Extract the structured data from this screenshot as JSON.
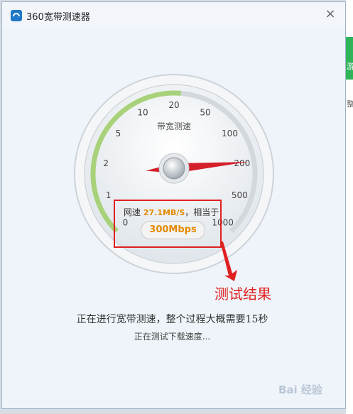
{
  "window": {
    "title": "360宽带测速器",
    "close_icon": "×"
  },
  "gauge": {
    "label": "带宽测速",
    "ticks": [
      "0",
      "1",
      "2",
      "5",
      "10",
      "20",
      "50",
      "100",
      "200",
      "500",
      "1000"
    ]
  },
  "reading": {
    "speed_label": "网速",
    "speed_value": "27.1MB/S",
    "equivalent_label": "，相当于",
    "mbps": "300Mbps"
  },
  "annotation": {
    "label": "测试结果",
    "color": "#e02020"
  },
  "status": {
    "main": "正在进行宽带测速，整个过程大概需要15秒",
    "sub": "正在测试下载速度..."
  },
  "background_app": {
    "text1": "游",
    "text2": "整"
  },
  "watermark": "Bai 经验",
  "colors": {
    "accent": "#e48a00",
    "needle": "#d3202a",
    "arc": "#a8d27a"
  }
}
